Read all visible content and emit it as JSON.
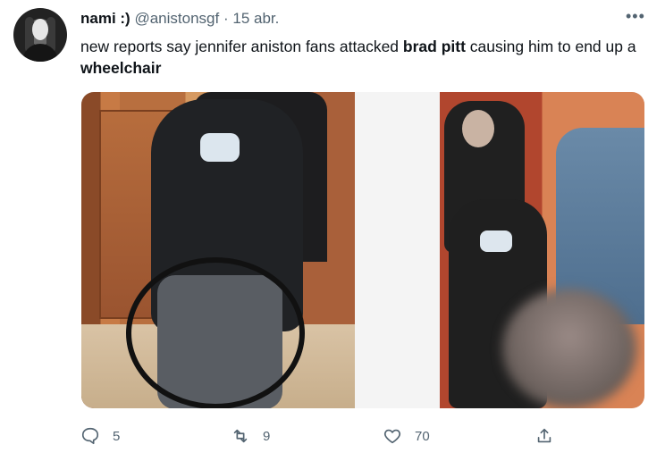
{
  "author": {
    "display_name": "nami :)",
    "handle": "@anistonsgf",
    "separator": "·",
    "date": "15 abr."
  },
  "more_label": "•••",
  "tweet": {
    "t1": "new reports say jennifer aniston fans attacked ",
    "t2": "brad pitt",
    "t3": " causing him to end up a ",
    "t4": "wheelchair"
  },
  "actions": {
    "reply_count": "5",
    "retweet_count": "9",
    "like_count": "70"
  },
  "icons": {
    "reply": "reply-icon",
    "retweet": "retweet-icon",
    "like": "heart-icon",
    "share": "share-icon"
  },
  "colors": {
    "text": "#0f1419",
    "secondary": "#536471"
  }
}
